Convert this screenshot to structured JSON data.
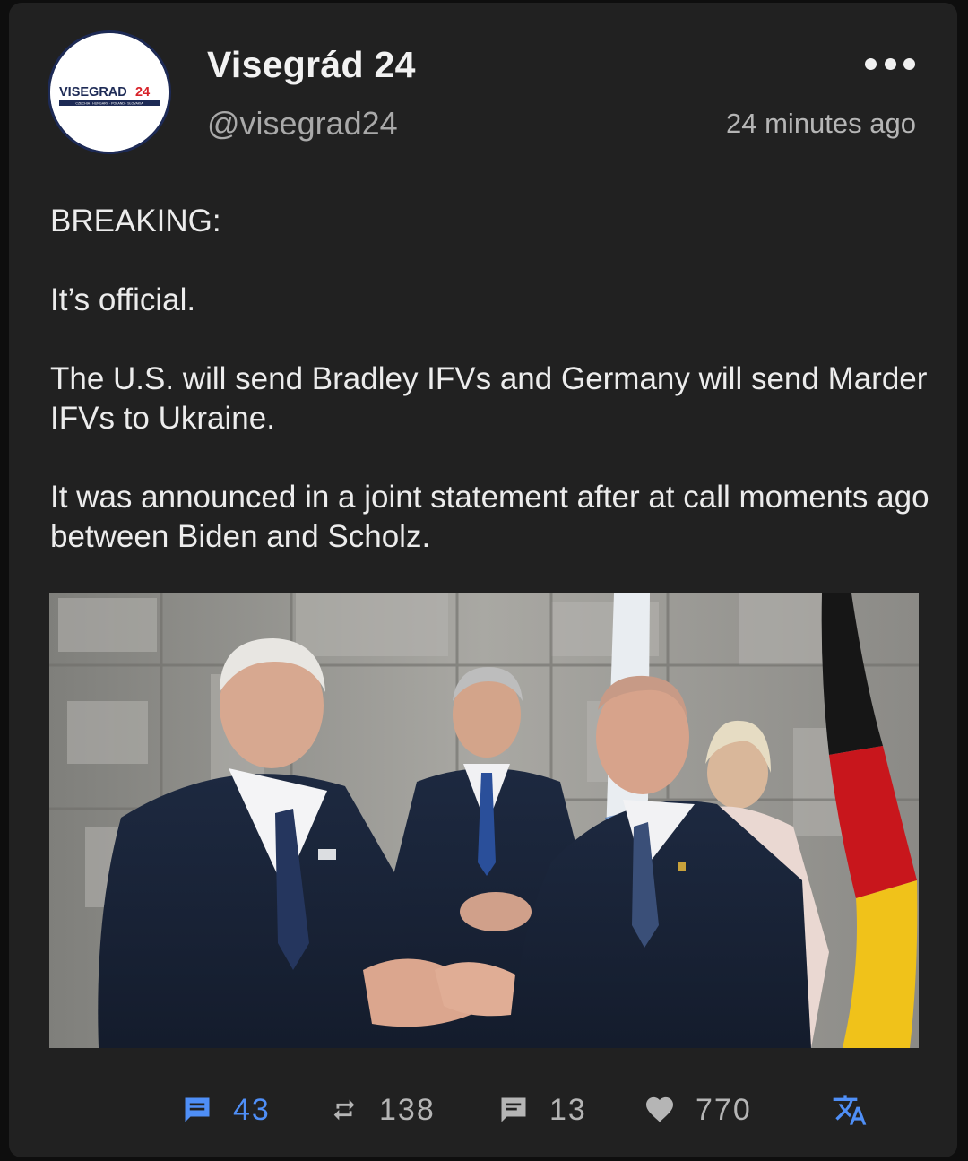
{
  "post": {
    "author": {
      "display_name": "Visegrád 24",
      "handle": "@visegrad24",
      "avatar_logo_text": "VISEGRAD",
      "avatar_logo_number": "24",
      "avatar_logo_subtext": "CZECHIA · HUNGARY · POLAND · SLOVAKIA"
    },
    "timestamp": "24 minutes ago",
    "text": {
      "p1": "BREAKING:",
      "p2": "It’s official.",
      "p3": "The U.S. will send Bradley IFVs and Germany will send Marder IFVs to Ukraine.",
      "p4": "It was announced in a joint statement after at call moments ago between Biden and Scholz."
    },
    "media": {
      "type": "photo"
    },
    "actions": {
      "replies": "43",
      "reblogs": "138",
      "quotes": "13",
      "likes": "770"
    }
  },
  "colors": {
    "card_background": "#212121",
    "accent_blue": "#4f8ff7",
    "muted_text": "#b5b5b5",
    "logo_navy": "#1d2a55",
    "logo_red": "#d8232a"
  },
  "icons": {
    "more": "more-horizontal-icon",
    "reply": "reply-bubble-icon",
    "reblog": "repeat-icon",
    "quote": "quote-bubble-icon",
    "like": "heart-icon",
    "translate": "translate-icon"
  }
}
